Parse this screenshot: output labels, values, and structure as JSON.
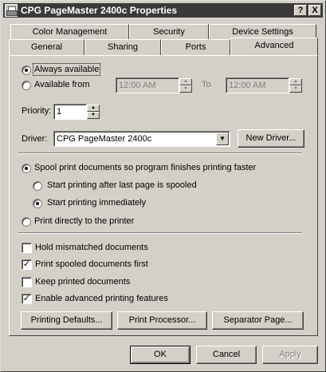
{
  "window": {
    "title": "CPG PageMaster 2400c Properties",
    "help_glyph": "?",
    "close_glyph": "X"
  },
  "tabs": {
    "row_back": [
      "Color Management",
      "Security",
      "Device Settings"
    ],
    "row_front": [
      "General",
      "Sharing",
      "Ports",
      "Advanced"
    ],
    "active": "Advanced"
  },
  "availability": {
    "always_label": "Always available",
    "from_label": "Available from",
    "from_time": "12:00 AM",
    "to_label": "To",
    "to_time": "12:00 AM",
    "selected": "always"
  },
  "priority": {
    "label": "Priority:",
    "value": "1"
  },
  "driver": {
    "label": "Driver:",
    "value": "CPG PageMaster 2400c",
    "new_driver_button": "New Driver..."
  },
  "spooling": {
    "spool_label": "Spool print documents so program finishes printing faster",
    "after_last_page_label": "Start printing after last page is spooled",
    "immediately_label": "Start printing immediately",
    "direct_label": "Print directly to the printer",
    "selected": "spool",
    "sub_selected": "immediately"
  },
  "options": [
    {
      "label": "Hold mismatched documents",
      "checked": false
    },
    {
      "label": "Print spooled documents first",
      "checked": true
    },
    {
      "label": "Keep printed documents",
      "checked": false
    },
    {
      "label": "Enable advanced printing features",
      "checked": true
    }
  ],
  "panel_buttons": {
    "defaults": "Printing Defaults...",
    "processor": "Print Processor...",
    "separator": "Separator Page..."
  },
  "dialog_buttons": {
    "ok": "OK",
    "cancel": "Cancel",
    "apply": "Apply"
  },
  "colors": {
    "face": "#d4d0c8",
    "titlebar": "#3a3a3a",
    "disabled_text": "#808080"
  }
}
